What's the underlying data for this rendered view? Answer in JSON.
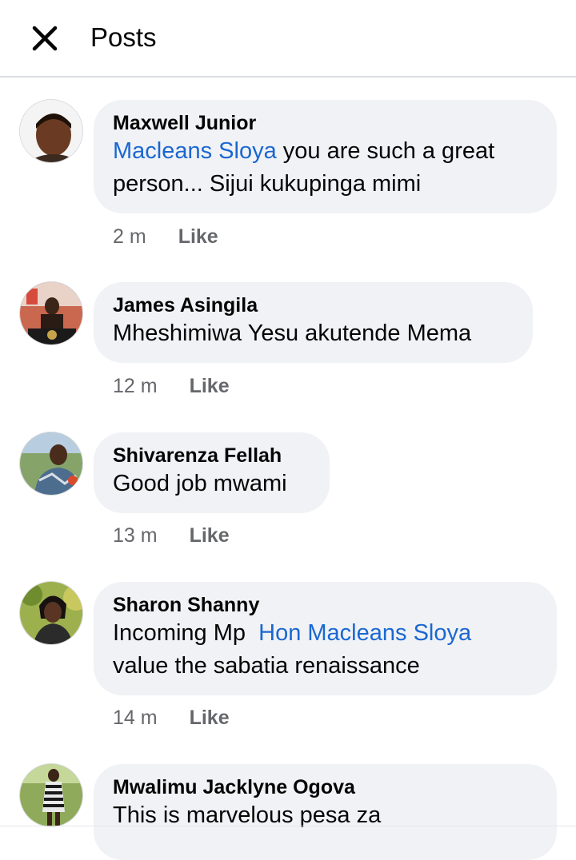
{
  "header": {
    "title": "Posts",
    "close_icon": "close-icon"
  },
  "colors": {
    "mention": "#1b67d1",
    "bubble": "#f0f2f5",
    "meta": "#65676b"
  },
  "comments": [
    {
      "author": "Maxwell Junior",
      "mention": "Macleans Sloya",
      "text_line1": " you are such a great",
      "text_line2": "person... Sijui kukupinga mimi",
      "time": "2 m",
      "like": "Like"
    },
    {
      "author": "James Asingila",
      "text_line1": "Mheshimiwa Yesu akutende Mema",
      "time": "12 m",
      "like": "Like"
    },
    {
      "author": "Shivarenza Fellah",
      "text_line1": "Good job mwami",
      "time": "13 m",
      "like": "Like"
    },
    {
      "author": "Sharon Shanny",
      "text_prefix": "Incoming Mp ",
      "mention": "Hon Macleans Sloya",
      "text_line2": "value the sabatia renaissance",
      "time": "14 m",
      "like": "Like"
    },
    {
      "author": "Mwalimu Jacklyne Ogova",
      "text_line1": "This is marvelous pesa za"
    }
  ]
}
